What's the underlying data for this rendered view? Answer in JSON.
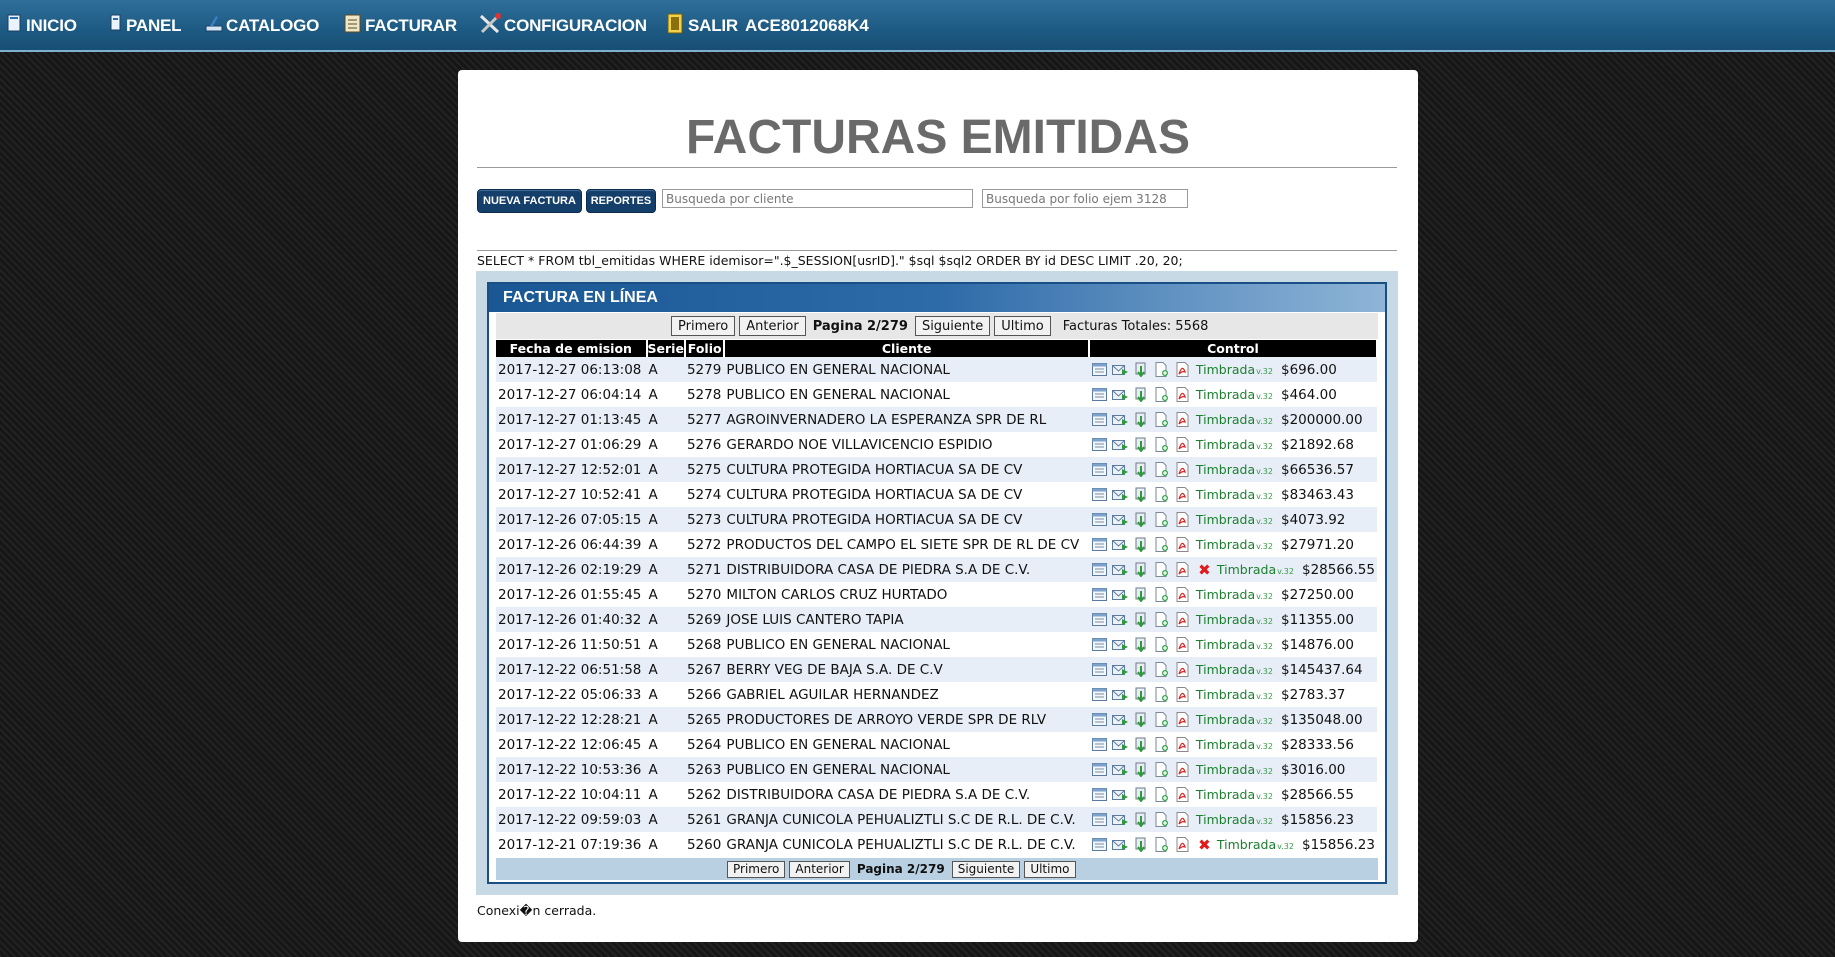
{
  "nav": {
    "items": [
      {
        "label": "INICIO",
        "icon": "home-icon"
      },
      {
        "label": "PANEL",
        "icon": "panel-icon"
      },
      {
        "label": "CATALOGO",
        "icon": "catalog-icon"
      },
      {
        "label": "FACTURAR",
        "icon": "invoice-icon"
      },
      {
        "label": "CONFIGURACION",
        "icon": "tools-icon"
      },
      {
        "label": "SALIR",
        "icon": "exit-icon"
      }
    ],
    "rfc": "ACE8012068K4"
  },
  "page": {
    "title": "FACTURAS EMITIDAS",
    "new_invoice_label": "NUEVA FACTURA",
    "reports_label": "REPORTES",
    "search_client_placeholder": "Busqueda por cliente",
    "search_folio_placeholder": "Busqueda por folio ejem 3128",
    "sql_text": "SELECT * FROM tbl_emitidas WHERE idemisor=\".$_SESSION[usrID].\" $sql $sql2 ORDER BY id DESC LIMIT .20, 20;",
    "footer_text": "Conexi�n cerrada."
  },
  "grid": {
    "title": "FACTURA EN LÍNEA",
    "pager": {
      "first": "Primero",
      "prev": "Anterior",
      "page_label": "Pagina 2/279",
      "next": "Siguiente",
      "last": "Ultimo",
      "total_label": "Facturas Totales: 5568"
    },
    "columns": [
      "Fecha de emision",
      "Serie",
      "Folio",
      "Cliente",
      "Control"
    ],
    "status_label": "Timbrada",
    "status_version": "v.32",
    "rows": [
      {
        "fecha": "2017-12-27 06:13:08",
        "serie": "A",
        "folio": "5279",
        "cliente": "PUBLICO EN GENERAL NACIONAL",
        "monto": "$696.00",
        "cancel": false
      },
      {
        "fecha": "2017-12-27 06:04:14",
        "serie": "A",
        "folio": "5278",
        "cliente": "PUBLICO EN GENERAL NACIONAL",
        "monto": "$464.00",
        "cancel": false
      },
      {
        "fecha": "2017-12-27 01:13:45",
        "serie": "A",
        "folio": "5277",
        "cliente": "AGROINVERNADERO LA ESPERANZA SPR DE RL",
        "monto": "$200000.00",
        "cancel": false
      },
      {
        "fecha": "2017-12-27 01:06:29",
        "serie": "A",
        "folio": "5276",
        "cliente": "GERARDO NOE VILLAVICENCIO ESPIDIO",
        "monto": "$21892.68",
        "cancel": false
      },
      {
        "fecha": "2017-12-27 12:52:01",
        "serie": "A",
        "folio": "5275",
        "cliente": "CULTURA PROTEGIDA HORTIACUA SA DE CV",
        "monto": "$66536.57",
        "cancel": false
      },
      {
        "fecha": "2017-12-27 10:52:41",
        "serie": "A",
        "folio": "5274",
        "cliente": "CULTURA PROTEGIDA HORTIACUA SA DE CV",
        "monto": "$83463.43",
        "cancel": false
      },
      {
        "fecha": "2017-12-26 07:05:15",
        "serie": "A",
        "folio": "5273",
        "cliente": "CULTURA PROTEGIDA HORTIACUA SA DE CV",
        "monto": "$4073.92",
        "cancel": false
      },
      {
        "fecha": "2017-12-26 06:44:39",
        "serie": "A",
        "folio": "5272",
        "cliente": "PRODUCTOS DEL CAMPO EL SIETE SPR DE RL DE CV",
        "monto": "$27971.20",
        "cancel": false
      },
      {
        "fecha": "2017-12-26 02:19:29",
        "serie": "A",
        "folio": "5271",
        "cliente": "DISTRIBUIDORA CASA DE PIEDRA S.A DE C.V.",
        "monto": "$28566.55",
        "cancel": true
      },
      {
        "fecha": "2017-12-26 01:55:45",
        "serie": "A",
        "folio": "5270",
        "cliente": "MILTON CARLOS CRUZ HURTADO",
        "monto": "$27250.00",
        "cancel": false
      },
      {
        "fecha": "2017-12-26 01:40:32",
        "serie": "A",
        "folio": "5269",
        "cliente": "JOSE LUIS CANTERO TAPIA",
        "monto": "$11355.00",
        "cancel": false
      },
      {
        "fecha": "2017-12-26 11:50:51",
        "serie": "A",
        "folio": "5268",
        "cliente": "PUBLICO EN GENERAL NACIONAL",
        "monto": "$14876.00",
        "cancel": false
      },
      {
        "fecha": "2017-12-22 06:51:58",
        "serie": "A",
        "folio": "5267",
        "cliente": "BERRY VEG DE BAJA S.A. DE C.V",
        "monto": "$145437.64",
        "cancel": false
      },
      {
        "fecha": "2017-12-22 05:06:33",
        "serie": "A",
        "folio": "5266",
        "cliente": "GABRIEL AGUILAR HERNANDEZ",
        "monto": "$2783.37",
        "cancel": false
      },
      {
        "fecha": "2017-12-22 12:28:21",
        "serie": "A",
        "folio": "5265",
        "cliente": "PRODUCTORES DE ARROYO VERDE SPR DE RLV",
        "monto": "$135048.00",
        "cancel": false
      },
      {
        "fecha": "2017-12-22 12:06:45",
        "serie": "A",
        "folio": "5264",
        "cliente": "PUBLICO EN GENERAL NACIONAL",
        "monto": "$28333.56",
        "cancel": false
      },
      {
        "fecha": "2017-12-22 10:53:36",
        "serie": "A",
        "folio": "5263",
        "cliente": "PUBLICO EN GENERAL NACIONAL",
        "monto": "$3016.00",
        "cancel": false
      },
      {
        "fecha": "2017-12-22 10:04:11",
        "serie": "A",
        "folio": "5262",
        "cliente": "DISTRIBUIDORA CASA DE PIEDRA S.A DE C.V.",
        "monto": "$28566.55",
        "cancel": false
      },
      {
        "fecha": "2017-12-22 09:59:03",
        "serie": "A",
        "folio": "5261",
        "cliente": "GRANJA CUNICOLA PEHUALIZTLI S.C DE R.L. DE C.V.",
        "monto": "$15856.23",
        "cancel": false
      },
      {
        "fecha": "2017-12-21 07:19:36",
        "serie": "A",
        "folio": "5260",
        "cliente": "GRANJA CUNICOLA PEHUALIZTLI S.C DE R.L. DE C.V.",
        "monto": "$15856.23",
        "cancel": true
      }
    ],
    "row_actions": [
      "view-icon",
      "email-icon",
      "xml-download-icon",
      "add-file-icon",
      "pdf-icon"
    ],
    "cancel_icon": "cancel-icon"
  }
}
